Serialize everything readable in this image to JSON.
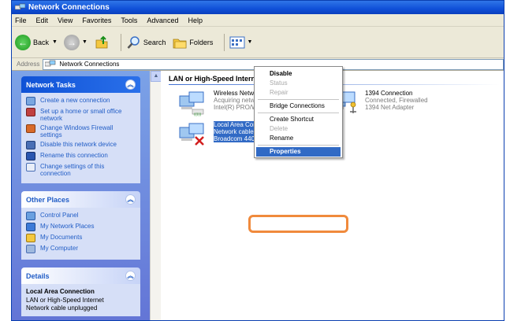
{
  "window": {
    "title": "Network Connections"
  },
  "menu": [
    "File",
    "Edit",
    "View",
    "Favorites",
    "Tools",
    "Advanced",
    "Help"
  ],
  "toolbar": {
    "back": "Back",
    "search": "Search",
    "folders": "Folders"
  },
  "address": {
    "label": "Address",
    "value": "Network Connections"
  },
  "left": {
    "network_tasks": {
      "title": "Network Tasks",
      "items": [
        "Create a new connection",
        "Set up a home or small office network",
        "Change Windows Firewall settings",
        "Disable this network device",
        "Rename this connection",
        "Change settings of this connection"
      ]
    },
    "other_places": {
      "title": "Other Places",
      "items": [
        "Control Panel",
        "My Network Places",
        "My Documents",
        "My Computer"
      ]
    },
    "details": {
      "title": "Details",
      "name": "Local Area Connection",
      "type": "LAN or High-Speed Internet",
      "status": "Network cable unplugged"
    }
  },
  "content": {
    "group_title": "LAN or High-Speed Internet",
    "connections": [
      {
        "name": "Wireless Network Connection",
        "status": "Acquiring network address, Fir...",
        "device": "Intel(R) PRO/Wireless 3945AB..."
      },
      {
        "name": "1394 Connection",
        "status": "Connected, Firewalled",
        "device": "1394 Net Adapter"
      },
      {
        "name": "Local Area Connection",
        "status": "Network cable unplugged, Fire...",
        "device": "Broadcom 440..."
      }
    ]
  },
  "context_menu": {
    "items": [
      "Disable",
      "Status",
      "Repair",
      "Bridge Connections",
      "Create Shortcut",
      "Delete",
      "Rename",
      "Properties"
    ]
  },
  "colors": {
    "selection": "#316ac5",
    "callout": "#f08a3c",
    "taskpane": "#6375d6"
  }
}
